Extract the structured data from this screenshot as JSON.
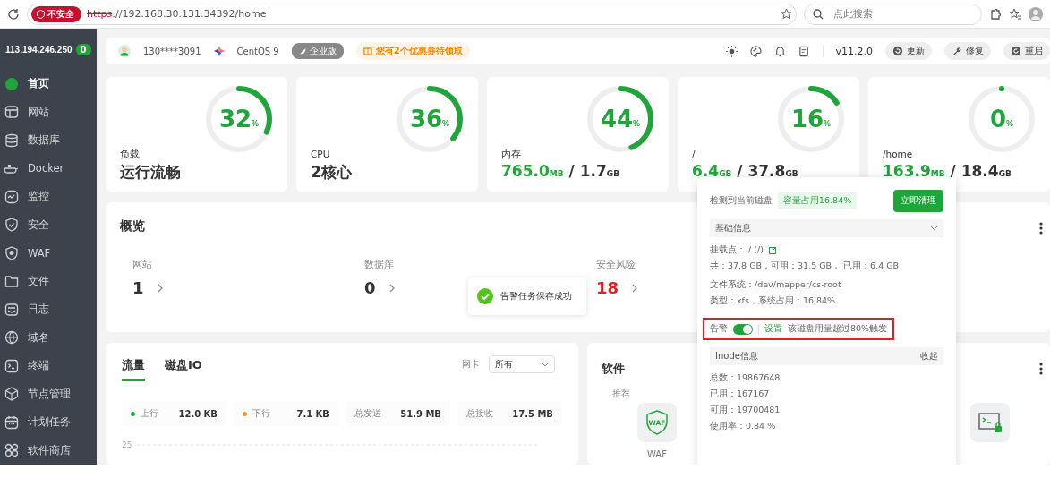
{
  "browser": {
    "security_badge": "不安全",
    "url_scheme": "https",
    "url_rest": "://192.168.30.131:34392/home",
    "search_placeholder": "点此搜索"
  },
  "sidebar": {
    "ip": "113.194.246.250",
    "ip_badge": "0",
    "items": [
      {
        "label": "首页",
        "selected": true
      },
      {
        "label": "网站",
        "selected": false
      },
      {
        "label": "数据库",
        "selected": false
      },
      {
        "label": "Docker",
        "selected": false
      },
      {
        "label": "监控",
        "selected": false
      },
      {
        "label": "安全",
        "selected": false
      },
      {
        "label": "WAF",
        "selected": false
      },
      {
        "label": "文件",
        "selected": false
      },
      {
        "label": "日志",
        "selected": false
      },
      {
        "label": "域名",
        "selected": false
      },
      {
        "label": "终端",
        "selected": false
      },
      {
        "label": "节点管理",
        "selected": false
      },
      {
        "label": "计划任务",
        "selected": false
      },
      {
        "label": "软件商店",
        "selected": false
      }
    ]
  },
  "header": {
    "user": "130****3091",
    "os": "CentOS 9",
    "edition": "企业版",
    "coupon": "您有2个优惠券待领取",
    "version": "v11.2.0",
    "buttons": [
      "更新",
      "修复",
      "重启"
    ]
  },
  "stat_cards": [
    {
      "label": "负载",
      "percent": "32",
      "unit": "%",
      "level": 0.32,
      "kind": "text",
      "detail_text": "运行流畅"
    },
    {
      "label": "CPU",
      "percent": "36",
      "unit": "%",
      "level": 0.36,
      "kind": "text",
      "detail_text": "2核心"
    },
    {
      "label": "内存",
      "percent": "44",
      "unit": "%",
      "level": 0.44,
      "kind": "usage",
      "used": "765.0",
      "used_unit": "MB",
      "sep": "/",
      "total": "1.7",
      "total_unit": "GB"
    },
    {
      "label": "/",
      "percent": "16",
      "unit": "%",
      "level": 0.16,
      "kind": "usage",
      "used": "6.4",
      "used_unit": "GB",
      "sep": "/",
      "total": "37.8",
      "total_unit": "GB"
    },
    {
      "label": "/home",
      "percent": "0",
      "unit": "%",
      "level": 0,
      "kind": "usage",
      "used": "163.9",
      "used_unit": "MB",
      "sep": "/",
      "total": "18.4",
      "total_unit": "GB"
    }
  ],
  "overview": {
    "title": "概览",
    "items": [
      {
        "label": "网站",
        "value": "1",
        "danger": false
      },
      {
        "label": "数据库",
        "value": "0",
        "danger": false
      },
      {
        "label": "安全风险",
        "value": "18",
        "danger": true
      }
    ]
  },
  "toast": {
    "message": "告警任务保存成功"
  },
  "traffic": {
    "tabs": [
      {
        "label": "流量",
        "selected": true
      },
      {
        "label": "磁盘IO",
        "selected": false
      }
    ],
    "nic_label": "网卡",
    "nic_value": "所有",
    "stats": [
      {
        "label": "上行",
        "value": "12.0 KB",
        "color": "#20a53a"
      },
      {
        "label": "下行",
        "value": "7.1 KB",
        "color": "#f59a23"
      },
      {
        "label": "总发送",
        "value": "51.9 MB"
      },
      {
        "label": "总接收",
        "value": "17.5 MB"
      }
    ],
    "y_tick": "25"
  },
  "software": {
    "title": "软件",
    "section": "推荐",
    "apps": [
      {
        "name": "WAF",
        "icon_text": "WAF"
      }
    ]
  },
  "disk_popover": {
    "detected": "检测到当前磁盘",
    "usage_tag": "容量占用16.84%",
    "clean_button": "立即清理",
    "basic": {
      "title": "基础信息",
      "mount": "挂载点：  / (/)",
      "sizes": "共：37.8 GB，可用：31.5 GB， 已用：6.4 GB",
      "fs": "文件系统：/dev/mapper/cs-root",
      "type": "类型：xfs，系统占用：16.84%"
    },
    "alert": {
      "label": "告警",
      "on": true,
      "highlighted": true,
      "settings_link": "设置",
      "rule": "该磁盘用量超过80%触发"
    },
    "inode": {
      "title": "Inode信息",
      "collapse": "收起",
      "lines": [
        "总数：19867648",
        "已用：167167",
        "可用：19700481",
        "使用率：0.84 %"
      ]
    }
  }
}
